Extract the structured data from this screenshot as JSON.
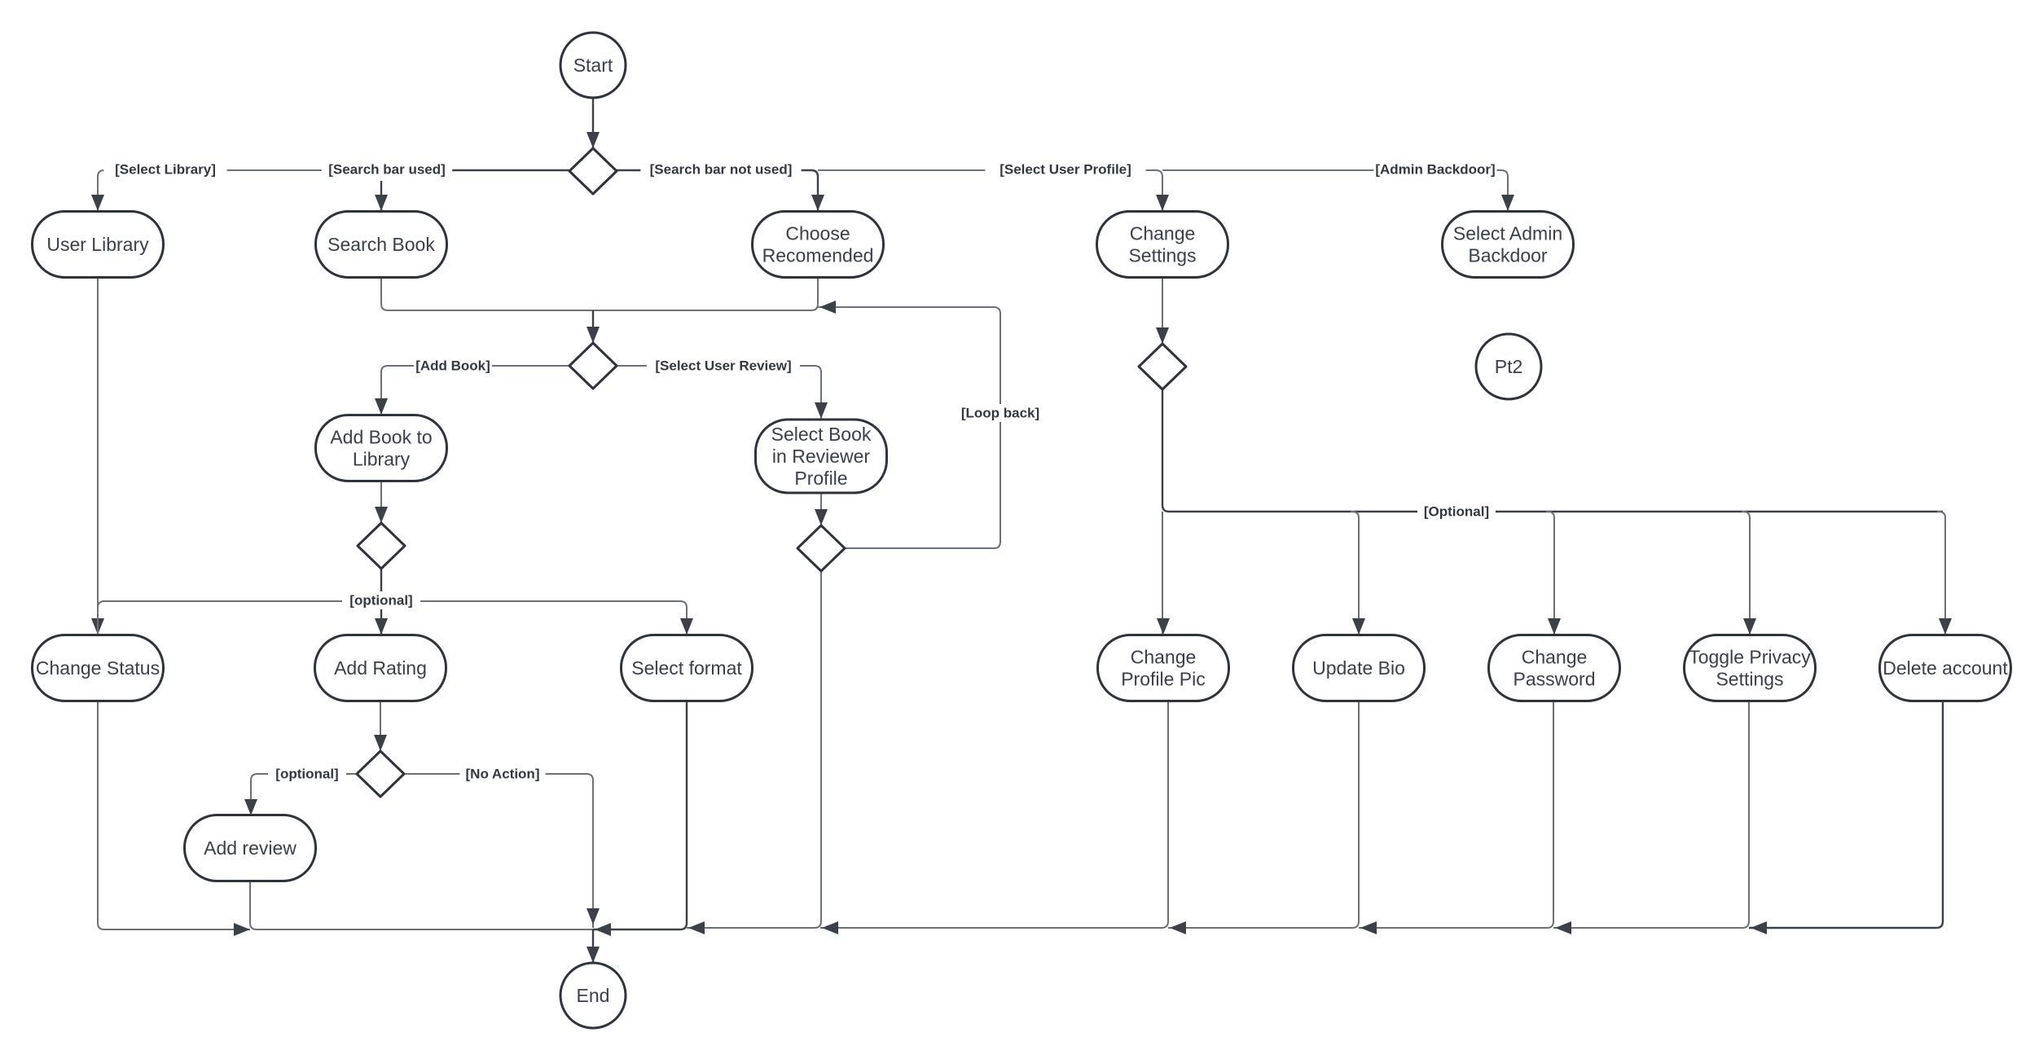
{
  "diagram": {
    "type": "UML activity diagram",
    "nodes": {
      "start": "Start",
      "end": "End",
      "pt2": "Pt2",
      "user_library": "User Library",
      "search_book": "Search Book",
      "choose_recommended": [
        "Choose",
        "Recomended"
      ],
      "change_settings": [
        "Change",
        "Settings"
      ],
      "select_admin_backdoor": [
        "Select Admin",
        "Backdoor"
      ],
      "add_book_to_library": [
        "Add Book to",
        "Library"
      ],
      "select_book_in_reviewer_profile": [
        "Select Book",
        "in Reviewer",
        "Profile"
      ],
      "change_status": "Change Status",
      "add_rating": "Add Rating",
      "select_format": "Select format",
      "add_review": "Add review",
      "change_profile_pic": [
        "Change",
        "Profile Pic"
      ],
      "update_bio": "Update Bio",
      "change_password": [
        "Change",
        "Password"
      ],
      "toggle_privacy_settings": [
        "Toggle Privacy",
        "Settings"
      ],
      "delete_account": "Delete account"
    },
    "guards": {
      "select_library": "[Select Library]",
      "search_bar_used": "[Search bar used]",
      "search_bar_not_used": "[Search bar not used]",
      "select_user_profile": "[Select User Profile]",
      "admin_backdoor": "[Admin Backdoor]",
      "add_book": "[Add Book]",
      "select_user_review": "[Select User Review]",
      "loop_back": "[Loop back]",
      "optional_library": "[optional]",
      "optional_review": "[optional]",
      "no_action": "[No Action]",
      "optional_settings": "[Optional]"
    }
  }
}
